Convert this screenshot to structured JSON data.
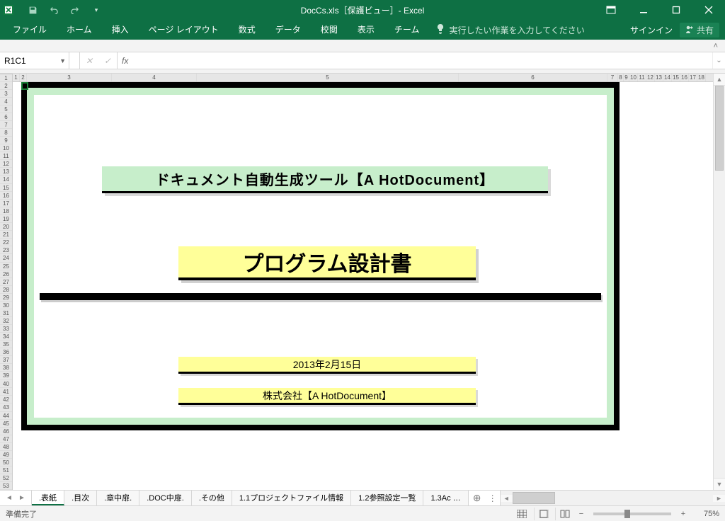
{
  "titlebar": {
    "title": "DocCs.xls［保護ビュー］- Excel"
  },
  "ribbon": {
    "tabs": {
      "file": "ファイル",
      "home": "ホーム",
      "insert": "挿入",
      "layout": "ページ レイアウト",
      "formulas": "数式",
      "data": "データ",
      "review": "校閲",
      "view": "表示",
      "team": "チーム"
    },
    "tellme": "実行したい作業を入力してください",
    "signin": "サインイン",
    "share": "共有"
  },
  "formula": {
    "namebox": "R1C1",
    "fx": "fx",
    "value": ""
  },
  "sheet_tabs": {
    "t1": ".表紙",
    "t2": ".目次",
    "t3": ".章中扉.",
    "t4": ".DOC中扉.",
    "t5": ".その他",
    "t6": "1.1プロジェクトファイル情報",
    "t7": "1.2参照設定一覧",
    "t8": "1.3Ac …"
  },
  "status": {
    "ready": "準備完了",
    "zoom": "75%"
  },
  "doc": {
    "green_title": "ドキュメント自動生成ツール【A HotDocument】",
    "main_title": "プログラム設計書",
    "date": "2013年2月15日",
    "company": "株式会社【A HotDocument】"
  },
  "col_widths": {
    "c1": 10,
    "c2": 10,
    "c3": 120,
    "c4": 120,
    "c5": 370,
    "c6": 220,
    "c7": 8,
    "c8": 8
  }
}
